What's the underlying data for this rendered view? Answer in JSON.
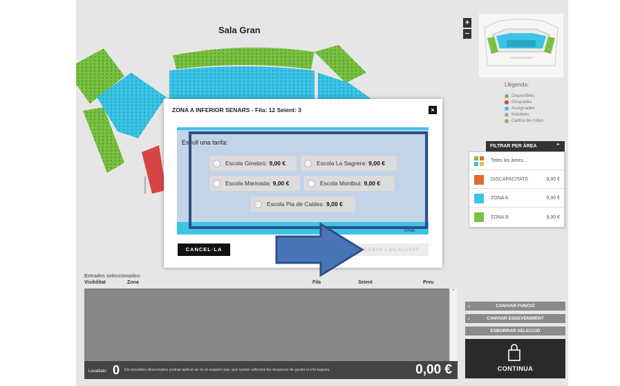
{
  "venue": {
    "title": "Sala Gran"
  },
  "zoom": {
    "plus": "+",
    "minus": "−"
  },
  "legend": {
    "title": "Llegenda:",
    "items": [
      {
        "label": "Disponibles",
        "color": "#7ac143"
      },
      {
        "label": "Ocupades",
        "color": "#e03c3c"
      },
      {
        "label": "Assignades",
        "color": "#3bc4e6"
      },
      {
        "label": "Inactives",
        "color": "#aaaaaa"
      },
      {
        "label": "Cadira de rodes",
        "color": "#7ac143"
      }
    ]
  },
  "filter": {
    "header": "FILTRAR PER ÀREA",
    "items": [
      {
        "name": "Totes les àrees...",
        "price": "",
        "icon": "all-areas-icon"
      },
      {
        "name": "DISCAPACITATS",
        "price": "9,00 €",
        "color": "#e06b2e"
      },
      {
        "name": "ZONA A",
        "price": "9,00 €",
        "color": "#3bc4e6"
      },
      {
        "name": "ZONA B",
        "price": "9,00 €",
        "color": "#7ac143"
      }
    ]
  },
  "selection": {
    "title": "Entrades seleccionades:",
    "columns": {
      "visibilitat": "Visibilitat",
      "zona": "Zona",
      "fila": "Fila",
      "seient": "Seient",
      "preu": "Preu"
    }
  },
  "footer": {
    "localitats_label": "Localitats:",
    "count": "0",
    "note": "Els possibles descomptes podran aplicar-se en el següent pas, que també reflectirà les despeses de gestió si n'hi haguès.",
    "total": "0,00 €"
  },
  "actions": {
    "canviar_funcio": "CANVIAR FUNCIÓ",
    "canviar_esdeveniment": "CANVIAR ESDEVENIMENT",
    "esborrar": "ESBORRAR SELECCIÓ",
    "continua": "CONTINUA"
  },
  "modal": {
    "title": "ZONA A INFERIOR SENARS - Fila: 12 Seient: 3",
    "close": "×",
    "prompt": "Escull una tarifa:",
    "fares": [
      {
        "name": "Escola Ginebró:",
        "price": "9,00 €"
      },
      {
        "name": "Escola La Sagrera:",
        "price": "9,00 €"
      },
      {
        "name": "Escola Marinada:",
        "price": "9,00 €"
      },
      {
        "name": "Escola Montbui:",
        "price": "9,00 €"
      },
      {
        "name": "Escola Pia de Caldes:",
        "price": "9,00 €"
      }
    ],
    "total_ghost": "Total:",
    "cancel": "CANCEL·LA",
    "add": "AFEGEIX LOCALITAT"
  }
}
